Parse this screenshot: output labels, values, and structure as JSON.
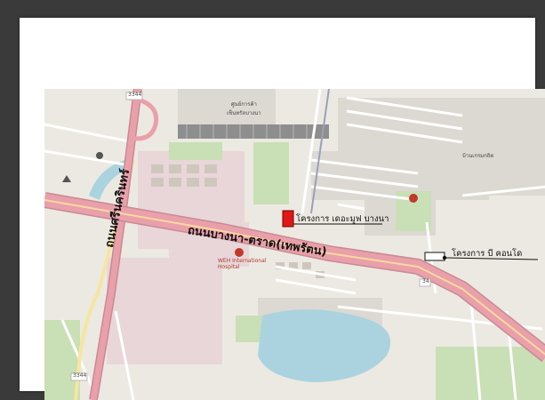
{
  "map": {
    "roads": {
      "bangna_trat": "ถนนบางนา-ตราด(เทพรัตน)",
      "srinakarin": "ถนนศรีนครินทร์"
    },
    "projects": {
      "project_one": "โครงการ เดอะมูฟ บางนา",
      "project_two": "โครงการ บี คอนโด"
    },
    "places": {
      "shopping_center": "ศูนย์การค้า\nเซ็นทรัลบางนา",
      "hospital": "WEH International\nHospital",
      "village": "บ้านเกรมกถิต"
    },
    "shields": [
      "3344",
      "3344",
      "34"
    ],
    "colors": {
      "highway_pink": "#e9a0aa",
      "marker_red": "#e01818",
      "park_green": "#c9dfb5",
      "water_blue": "#aad3df"
    }
  }
}
